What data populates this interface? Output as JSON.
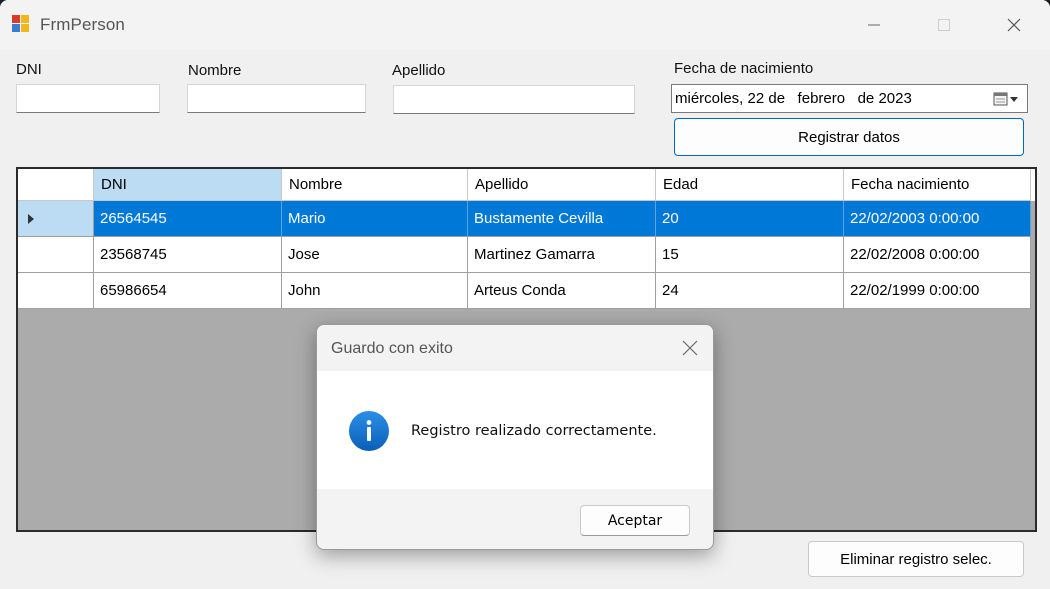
{
  "window": {
    "title": "FrmPerson"
  },
  "form": {
    "dni_label": "DNI",
    "nombre_label": "Nombre",
    "apellido_label": "Apellido",
    "fecha_label": "Fecha de nacimiento",
    "dni_value": "",
    "nombre_value": "",
    "apellido_value": "",
    "fecha_value": "miércoles, 22 de   febrero   de 2023",
    "registrar_label": "Registrar datos",
    "eliminar_label": "Eliminar registro selec."
  },
  "table": {
    "columns": [
      "DNI",
      "Nombre",
      "Apellido",
      "Edad",
      "Fecha nacimiento"
    ],
    "rows": [
      [
        "26564545",
        "Mario",
        "Bustamente Cevilla",
        "20",
        "22/02/2003 0:00:00"
      ],
      [
        "23568745",
        "Jose",
        "Martinez Gamarra",
        "15",
        "22/02/2008 0:00:00"
      ],
      [
        "65986654",
        "John",
        "Arteus Conda",
        "24",
        "22/02/1999 0:00:00"
      ]
    ],
    "selected_row": 0
  },
  "dialog": {
    "title": "Guardo con exito",
    "message": "Registro realizado correctamente.",
    "ok_label": "Aceptar"
  },
  "colors": {
    "accent": "#0078d7",
    "selection_header": "#bcdcf4",
    "grid_background": "#ababab"
  }
}
